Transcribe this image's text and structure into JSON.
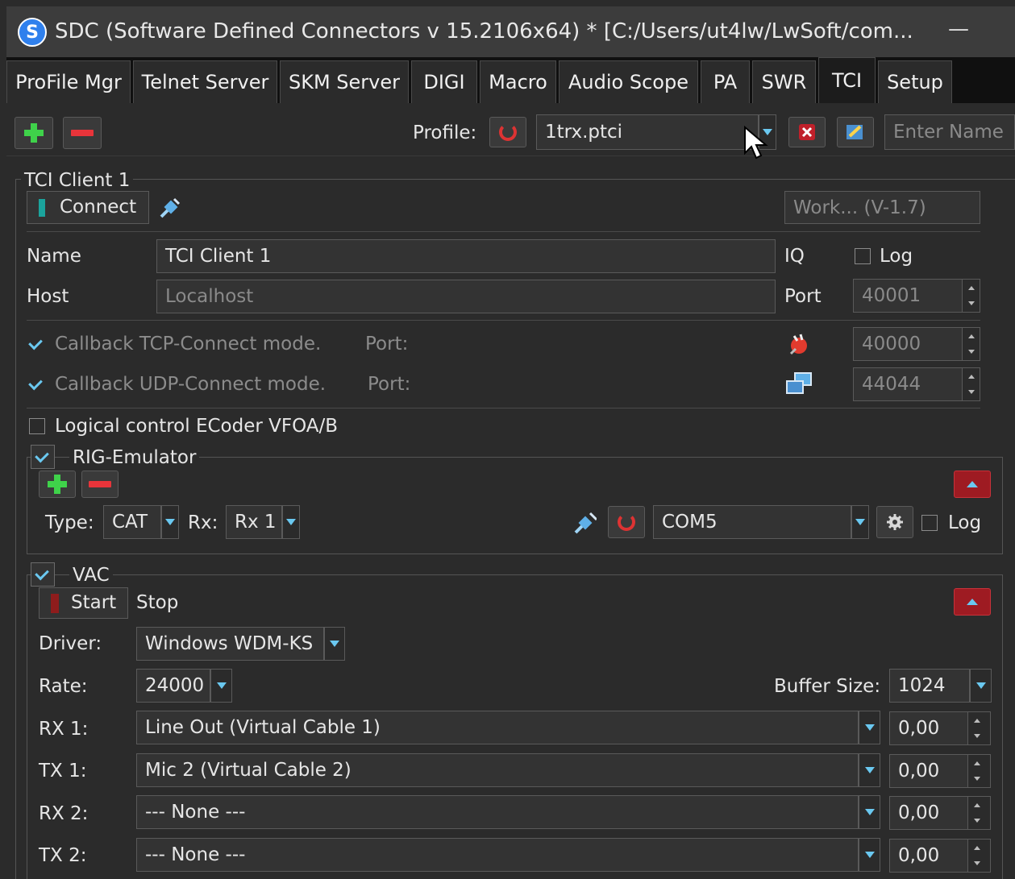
{
  "window": {
    "title": "SDC (Software Defined Connectors v 15.2106x64) * [C:/Users/ut4lw/LwSoft/com...",
    "app_icon": "S"
  },
  "tabs": [
    "ProFile Mgr",
    "Telnet Server",
    "SKM Server",
    "DIGI",
    "Macro",
    "Audio Scope",
    "PA",
    "SWR",
    "TCI",
    "Setup"
  ],
  "active_tab": "TCI",
  "toolbar": {
    "profile_label": "Profile:",
    "profile_value": "1trx.ptci",
    "name_placeholder": "Enter Name"
  },
  "client": {
    "group_title": "TCI Client 1",
    "connect_label": "Connect",
    "status_placeholder": "Work... (V-1.7)",
    "name_label": "Name",
    "name_value": "TCI Client 1",
    "iq_label": "IQ",
    "log_label": "Log",
    "host_label": "Host",
    "host_placeholder": "Localhost",
    "port_label": "Port",
    "port_value": "40001",
    "callback_tcp_label": "Callback TCP-Connect mode.",
    "callback_tcp_port_label": "Port:",
    "callback_tcp_port": "40000",
    "callback_udp_label": "Callback UDP-Connect mode.",
    "callback_udp_port_label": "Port:",
    "callback_udp_port": "44044",
    "ecoder_label": "Logical control ECoder VFOA/B"
  },
  "rig": {
    "group_title": "RIG-Emulator",
    "type_label": "Type:",
    "type_value": "CAT",
    "rx_label": "Rx:",
    "rx_value": "Rx 1",
    "com_value": "COM5",
    "log_label": "Log"
  },
  "vac": {
    "group_title": "VAC",
    "start_label": "Start",
    "stop_label": "Stop",
    "driver_label": "Driver:",
    "driver_value": "Windows WDM-KS",
    "rate_label": "Rate:",
    "rate_value": "24000",
    "buffer_label": "Buffer Size:",
    "buffer_value": "1024",
    "channels": [
      {
        "label": "RX 1:",
        "device": "Line Out (Virtual Cable 1)",
        "gain": "0,00"
      },
      {
        "label": "TX 1:",
        "device": "Mic 2 (Virtual Cable 2)",
        "gain": "0,00"
      },
      {
        "label": "RX 2:",
        "device": "--- None ---",
        "gain": "0,00"
      },
      {
        "label": "TX 2:",
        "device": "--- None ---",
        "gain": "0,00"
      }
    ]
  }
}
